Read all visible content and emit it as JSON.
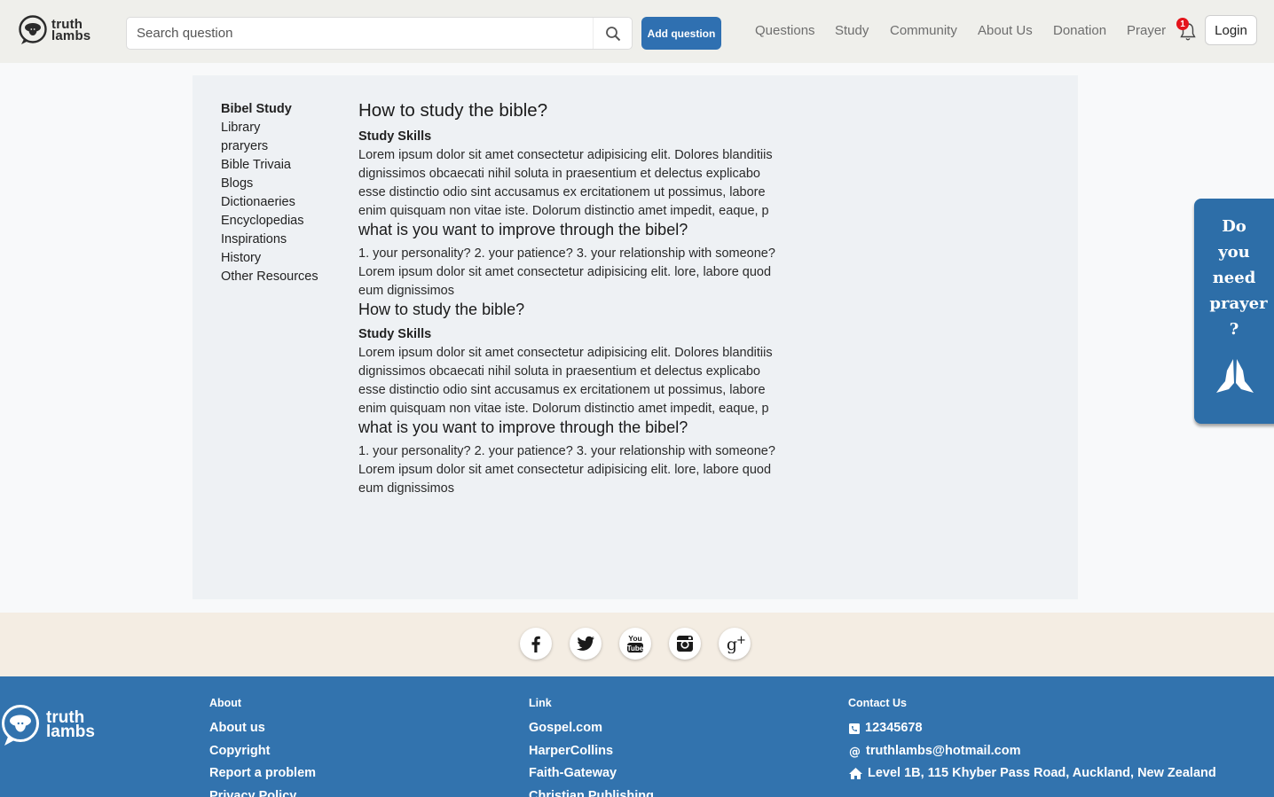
{
  "header": {
    "logo": {
      "line1": "truth",
      "line2": "lambs"
    },
    "search": {
      "placeholder": "Search question"
    },
    "add_question": "Add question",
    "nav": [
      "Questions",
      "Study",
      "Community",
      "About Us",
      "Donation",
      "Prayer"
    ],
    "notifications_count": "1",
    "login": "Login"
  },
  "sidebar": {
    "items": [
      "Bibel Study",
      "Library",
      "praryers",
      "Bible Trivaia",
      "Blogs",
      "Dictionaeries",
      "Encyclopedias",
      "Inspirations",
      "History",
      "Other Resources"
    ]
  },
  "article": {
    "sections": [
      {
        "title": "How to study the bible?",
        "subtitle": "Study Skills",
        "body": "Lorem ipsum dolor sit amet consectetur adipisicing elit. Dolores blanditiis dignissimos obcaecati nihil soluta in praesentium et delectus explicabo esse distinctio odio sint accusamus ex ercitationem ut possimus, labore enim quisquam non vitae iste. Dolorum distinctio amet impedit, eaque, p",
        "question": "what is you want to improve through the bibel?",
        "list": "1. your personality? 2. your patience? 3. your relationship with someone?",
        "body2": "Lorem ipsum dolor sit amet consectetur adipisicing elit. lore, labore quod eum dignissimos"
      },
      {
        "title": "How to study the bible?",
        "subtitle": "Study Skills",
        "body": "Lorem ipsum dolor sit amet consectetur adipisicing elit. Dolores blanditiis dignissimos obcaecati nihil soluta in praesentium et delectus explicabo esse distinctio odio sint accusamus ex ercitationem ut possimus, labore enim quisquam non vitae iste. Dolorum distinctio amet impedit, eaque, p",
        "question": "what is you want to improve through the bibel?",
        "list": "1. your personality? 2. your patience? 3. your relationship with someone?",
        "body2": "Lorem ipsum dolor sit amet consectetur adipisicing elit. lore, labore quod eum dignissimos"
      }
    ]
  },
  "prayer_widget": {
    "lines": [
      "Do",
      "you",
      "need",
      "prayer",
      "?"
    ],
    "icon": "praying-hands-icon"
  },
  "social": [
    "facebook-icon",
    "twitter-icon",
    "youtube-icon",
    "instagram-icon",
    "google-plus-icon"
  ],
  "footer": {
    "logo": {
      "line1": "truth",
      "line2": "lambs"
    },
    "about": {
      "heading": "About",
      "links": [
        "About us",
        "Copyright",
        "Report a problem",
        "Privacy Policy"
      ]
    },
    "link": {
      "heading": "Link",
      "links": [
        "Gospel.com",
        "HarperCollins",
        "Faith-Gateway",
        "Christian Publishing"
      ]
    },
    "contact": {
      "heading": "Contact Us",
      "phone": "12345678",
      "email": "truthlambs@hotmail.com",
      "address": "Level 1B, 115 Khyber Pass Road, Auckland, New Zealand"
    }
  },
  "colors": {
    "primary": "#2f70b1",
    "footer": "#3273ae",
    "header_bg": "#efefeb",
    "badge": "#e4141b",
    "social_strip": "#f4ede3"
  }
}
